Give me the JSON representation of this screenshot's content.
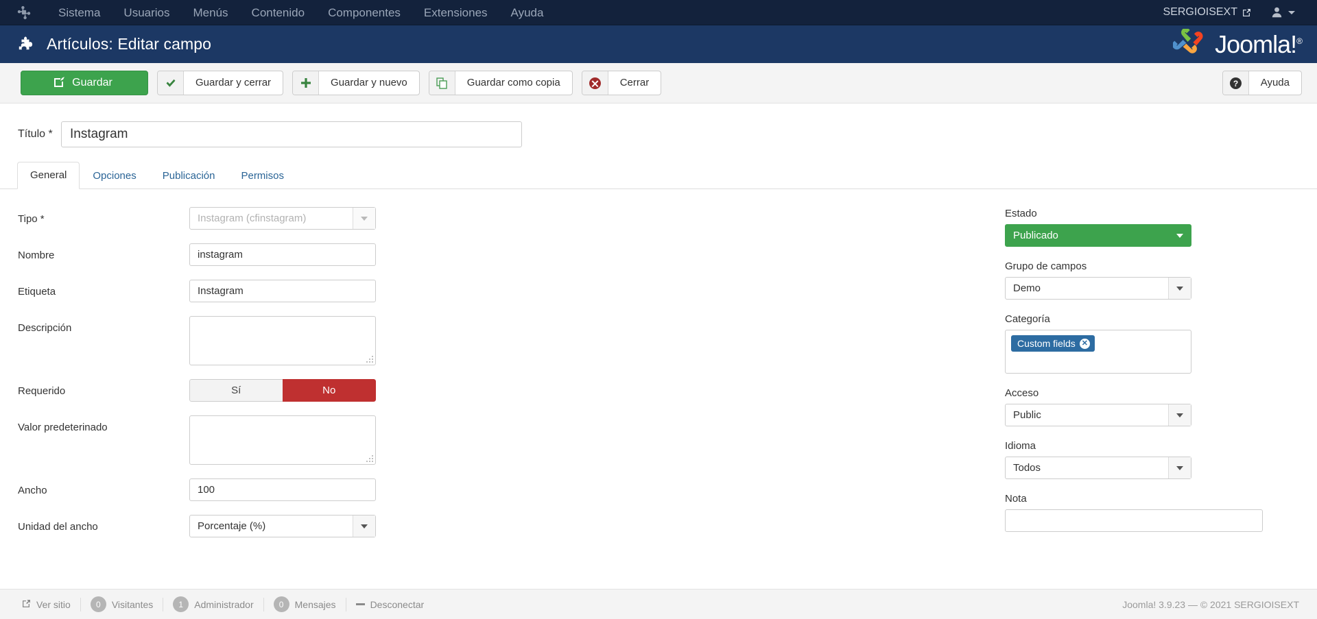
{
  "topbar": {
    "brand_icon": "joomla-mark-icon",
    "menu": [
      {
        "label": "Sistema"
      },
      {
        "label": "Usuarios"
      },
      {
        "label": "Menús"
      },
      {
        "label": "Contenido"
      },
      {
        "label": "Componentes"
      },
      {
        "label": "Extensiones"
      },
      {
        "label": "Ayuda"
      }
    ],
    "site_name": "SERGIOISEXT",
    "site_icon": "external-link-icon",
    "user_icon": "user-icon",
    "user_caret_icon": "chevron-down-icon"
  },
  "subhead": {
    "icon": "puzzle-piece-icon",
    "title": "Artículos: Editar campo",
    "logo_text": "Joomla!",
    "logo_sup": "®"
  },
  "toolbar": {
    "save_label": "Guardar",
    "save_icon": "edit-pencil-icon",
    "save_close_label": "Guardar y cerrar",
    "save_close_icon": "check-icon",
    "save_new_label": "Guardar y nuevo",
    "save_new_icon": "plus-icon",
    "save_copy_label": "Guardar como copia",
    "save_copy_icon": "copy-icon",
    "close_label": "Cerrar",
    "close_icon": "circle-x-icon",
    "help_label": "Ayuda",
    "help_icon": "question-circle-icon"
  },
  "form": {
    "title_label": "Título *",
    "title_value": "Instagram",
    "title_placeholder": ""
  },
  "tabs": [
    {
      "label": "General",
      "active": true
    },
    {
      "label": "Opciones",
      "active": false
    },
    {
      "label": "Publicación",
      "active": false
    },
    {
      "label": "Permisos",
      "active": false
    }
  ],
  "left_fields": {
    "tipo_label": "Tipo *",
    "tipo_value": "Instagram (cfinstagram)",
    "nombre_label": "Nombre",
    "nombre_value": "instagram",
    "etiqueta_label": "Etiqueta",
    "etiqueta_value": "Instagram",
    "descripcion_label": "Descripción",
    "descripcion_value": "",
    "requerido_label": "Requerido",
    "requerido_yes": "Sí",
    "requerido_no": "No",
    "requerido_selected": "No",
    "valor_label": "Valor predeterinado",
    "valor_value": "",
    "ancho_label": "Ancho",
    "ancho_value": "100",
    "unidad_label": "Unidad del ancho",
    "unidad_value": "Porcentaje (%)"
  },
  "right_fields": {
    "estado_label": "Estado",
    "estado_value": "Publicado",
    "grupo_label": "Grupo de campos",
    "grupo_value": "Demo",
    "categoria_label": "Categoría",
    "categoria_chip": "Custom fields",
    "categoria_chip_remove": "✕",
    "acceso_label": "Acceso",
    "acceso_value": "Public",
    "idioma_label": "Idioma",
    "idioma_value": "Todos",
    "nota_label": "Nota",
    "nota_value": ""
  },
  "footer": {
    "view_site_label": "Ver sitio",
    "view_site_icon": "external-link-icon",
    "visitors_count": "0",
    "visitors_label": "Visitantes",
    "admin_count": "1",
    "admin_label": "Administrador",
    "messages_count": "0",
    "messages_label": "Mensajes",
    "logout_label": "Desconectar",
    "logout_icon": "minus-icon",
    "copyright": "Joomla! 3.9.23  —  © 2021 SERGIOISEXT"
  },
  "colors": {
    "topbar": "#13223c",
    "subhead": "#1c3864",
    "primary_green": "#3da34d",
    "danger_red": "#bf3030",
    "chip_blue": "#2d6ca2",
    "link_blue": "#2a6496"
  }
}
